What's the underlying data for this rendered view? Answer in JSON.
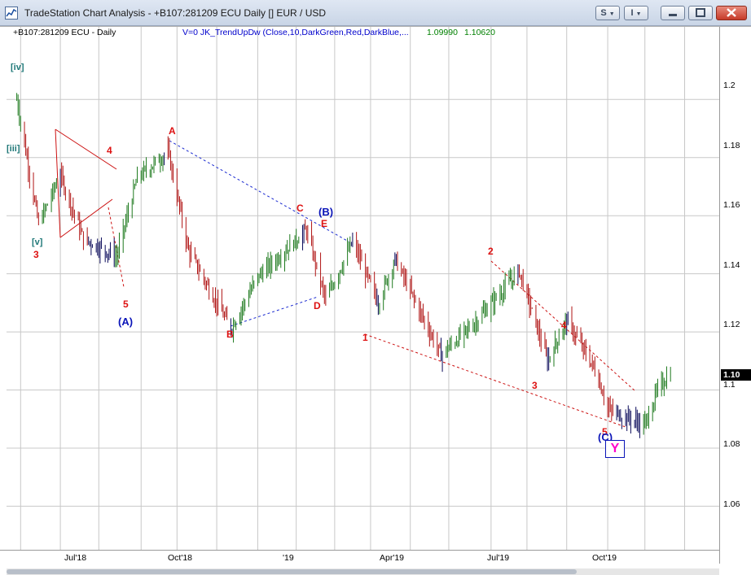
{
  "window": {
    "title": "TradeStation Chart Analysis - +B107:281209 ECU Daily [] EUR / USD",
    "symbol_button": "S",
    "interval_button": "I"
  },
  "chart": {
    "symbol_info": "+B107:281209 ECU - Daily",
    "study_label": "V=0  JK_TrendUpDw  (Close,10,DarkGreen,Red,DarkBlue,...",
    "study_value_1": "1.09990",
    "study_value_2": "1.10620",
    "last_price": "1.10",
    "colors": {
      "up": "#1e7a1e",
      "down": "#b01414",
      "neutral": "#0a0a5a",
      "wave_red": "#dd1111",
      "wave_blue": "#0a14b8"
    }
  },
  "price_axis": {
    "labels": [
      "1.2",
      "1.18",
      "1.16",
      "1.14",
      "1.12",
      "1.1",
      "1.08",
      "1.06"
    ]
  },
  "time_axis": {
    "labels": [
      "Jul'18",
      "Oct'18",
      "'19",
      "Apr'19",
      "Jul'19",
      "Oct'19"
    ]
  },
  "wave_labels": {
    "iv": "[iv]",
    "iii": "[iii]",
    "v": "[v]",
    "w3": "3",
    "w4": "4",
    "w5": "5",
    "A_paren": "(A)",
    "A": "A",
    "B": "B",
    "C": "C",
    "D": "D",
    "E": "E",
    "B_paren": "(B)",
    "n1": "1",
    "n2": "2",
    "n3": "3",
    "n4": "4",
    "n5": "5",
    "C_paren": "(C)",
    "Y": "Y"
  },
  "chart_data": {
    "type": "line",
    "title": "EUR / USD Daily",
    "xlabel": "",
    "ylabel": "",
    "ylim": [
      1.045,
      1.225
    ],
    "grid": true,
    "x": [
      "2018-05-29",
      "2018-06-15",
      "2018-07-02",
      "2018-07-20",
      "2018-08-15",
      "2018-08-31",
      "2018-09-24",
      "2018-10-10",
      "2018-11-12",
      "2018-12-03",
      "2019-01-10",
      "2019-01-25",
      "2019-02-15",
      "2019-03-07",
      "2019-03-20",
      "2019-04-25",
      "2019-05-23",
      "2019-06-25",
      "2019-07-17",
      "2019-08-01",
      "2019-08-23",
      "2019-09-03",
      "2019-10-01",
      "2019-10-11",
      "2019-10-21"
    ],
    "series": [
      {
        "name": "",
        "values": [
          1.2,
          1.157,
          1.174,
          1.152,
          1.146,
          1.173,
          1.182,
          1.148,
          1.121,
          1.139,
          1.155,
          1.131,
          1.151,
          1.13,
          1.145,
          1.112,
          1.124,
          1.141,
          1.11,
          1.124,
          1.107,
          1.093,
          1.088,
          1.1,
          1.106
        ]
      }
    ]
  }
}
